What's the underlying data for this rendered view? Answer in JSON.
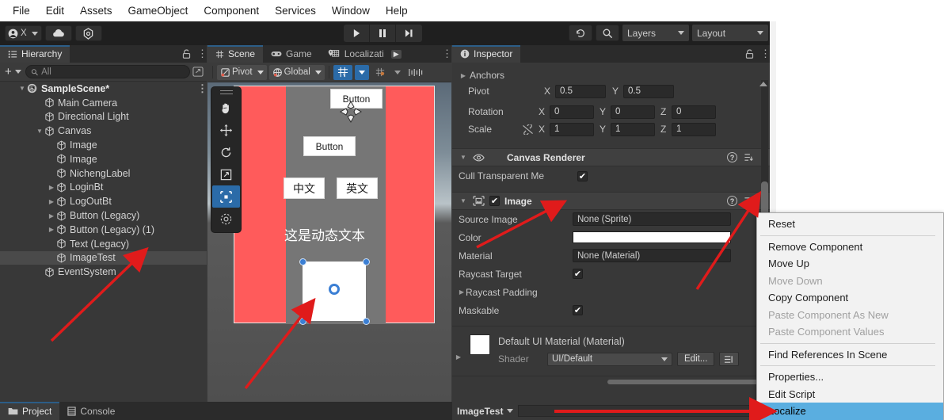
{
  "menubar": {
    "items": [
      "File",
      "Edit",
      "Assets",
      "GameObject",
      "Component",
      "Services",
      "Window",
      "Help"
    ]
  },
  "toolbar": {
    "account_label": "X",
    "cloud_icon": "cloud-icon",
    "settings_icon": "gear-icon",
    "play_icon": "play-icon",
    "pause_icon": "pause-icon",
    "step_icon": "step-icon",
    "history_icon": "undo-history-icon",
    "search_icon": "search-icon",
    "layers_label": "Layers",
    "layout_label": "Layout"
  },
  "hierarchy": {
    "tab_label": "Hierarchy",
    "lock_icon": "lock-icon",
    "menu_icon": "kebab-icon",
    "add_label": "+",
    "search_placeholder": "All",
    "scene_name": "SampleScene*",
    "items": [
      {
        "label": "Main Camera",
        "indent": 2,
        "expandable": false,
        "selected": false
      },
      {
        "label": "Directional Light",
        "indent": 2,
        "expandable": false,
        "selected": false
      },
      {
        "label": "Canvas",
        "indent": 2,
        "expandable": true,
        "expanded": true,
        "selected": false
      },
      {
        "label": "Image",
        "indent": 3,
        "expandable": false,
        "selected": false
      },
      {
        "label": "Image",
        "indent": 3,
        "expandable": false,
        "selected": false
      },
      {
        "label": "NichengLabel",
        "indent": 3,
        "expandable": false,
        "selected": false
      },
      {
        "label": "LoginBt",
        "indent": 3,
        "expandable": true,
        "expanded": false,
        "selected": false
      },
      {
        "label": "LogOutBt",
        "indent": 3,
        "expandable": true,
        "expanded": false,
        "selected": false
      },
      {
        "label": "Button (Legacy)",
        "indent": 3,
        "expandable": true,
        "expanded": false,
        "selected": false
      },
      {
        "label": "Button (Legacy) (1)",
        "indent": 3,
        "expandable": true,
        "expanded": false,
        "selected": false
      },
      {
        "label": "Text (Legacy)",
        "indent": 3,
        "expandable": false,
        "selected": false
      },
      {
        "label": "ImageTest",
        "indent": 3,
        "expandable": false,
        "selected": true
      },
      {
        "label": "EventSystem",
        "indent": 2,
        "expandable": false,
        "selected": false
      }
    ]
  },
  "scene": {
    "tabs": [
      {
        "label": "Scene",
        "icon": "grid-icon",
        "active": true
      },
      {
        "label": "Game",
        "icon": "gamepad-icon",
        "active": false
      },
      {
        "label": "Localizati",
        "icon": "localization-pin-icon",
        "active": false
      }
    ],
    "overflow_icon": "chevron-right-icon",
    "menu_icon": "kebab-icon",
    "toolbar": {
      "pivot_label": "Pivot",
      "space_label": "Global",
      "grid_icon": "grid-axis-y-icon",
      "snap_icon": "grid-snap-icon",
      "scale_icon": "scale-slider-icon"
    },
    "tools": [
      {
        "name": "hand-tool",
        "active": false
      },
      {
        "name": "move-tool",
        "active": false
      },
      {
        "name": "rotate-tool",
        "active": false
      },
      {
        "name": "scale-tool",
        "active": false
      },
      {
        "name": "rect-tool",
        "active": true
      },
      {
        "name": "transform-tool",
        "active": false
      }
    ],
    "content": {
      "button_top": "Button",
      "button_second": "Button",
      "button_cn": "中文",
      "button_en": "英文",
      "dynamic_text": "这是动态文本"
    }
  },
  "inspector": {
    "tab_label": "Inspector",
    "info_icon": "info-icon",
    "lock_icon": "lock-icon",
    "menu_icon": "kebab-icon",
    "rect_transform": {
      "anchors_label": "Anchors",
      "pivot_label": "Pivot",
      "pivot_x": "0.5",
      "pivot_y": "0.5",
      "rotation_label": "Rotation",
      "rotation_x": "0",
      "rotation_y": "0",
      "rotation_z": "0",
      "scale_label": "Scale",
      "scale_x": "1",
      "scale_y": "1",
      "scale_z": "1",
      "axis_x": "X",
      "axis_y": "Y",
      "axis_z": "Z",
      "link_icon": "broken-link-icon"
    },
    "canvas_renderer": {
      "title": "Canvas Renderer",
      "icon": "eye-icon",
      "cull_label": "Cull Transparent Me",
      "cull_checked": true
    },
    "image_component": {
      "title": "Image",
      "icon": "image-component-icon",
      "enabled": true,
      "source_image_label": "Source Image",
      "source_image_value": "None (Sprite)",
      "color_label": "Color",
      "color_value": "#FFFFFF",
      "material_label": "Material",
      "material_value": "None (Material)",
      "raycast_target_label": "Raycast Target",
      "raycast_target_checked": true,
      "raycast_padding_label": "Raycast Padding",
      "maskable_label": "Maskable",
      "maskable_checked": true
    },
    "material_block": {
      "title": "Default UI Material (Material)",
      "shader_label": "Shader",
      "shader_value": "UI/Default",
      "edit_label": "Edit...",
      "list_icon": "preset-list-icon"
    }
  },
  "context_menu": {
    "items": [
      {
        "label": "Reset",
        "state": "normal"
      },
      {
        "label": "__SEP__",
        "state": "sep"
      },
      {
        "label": "Remove Component",
        "state": "normal"
      },
      {
        "label": "Move Up",
        "state": "normal"
      },
      {
        "label": "Move Down",
        "state": "disabled"
      },
      {
        "label": "Copy Component",
        "state": "normal"
      },
      {
        "label": "Paste Component As New",
        "state": "disabled"
      },
      {
        "label": "Paste Component Values",
        "state": "disabled"
      },
      {
        "label": "__SEP__",
        "state": "sep"
      },
      {
        "label": "Find References In Scene",
        "state": "normal"
      },
      {
        "label": "__SEP__",
        "state": "sep"
      },
      {
        "label": "Properties...",
        "state": "normal"
      },
      {
        "label": "Edit Script",
        "state": "normal"
      },
      {
        "label": "Localize",
        "state": "highlight"
      }
    ]
  },
  "bottom": {
    "project_label": "Project",
    "console_label": "Console",
    "project_icon": "folder-icon",
    "console_icon": "console-icon",
    "lock_icon": "lock-icon",
    "menu_icon": "kebab-icon",
    "selected_object": "ImageTest"
  },
  "colors": {
    "accent_blue": "#2b6ba8",
    "highlight_blue": "#5aaee0",
    "canvas_red": "#ff5b5b",
    "annotation_red": "#e01b1b",
    "panel_bg": "#383838",
    "toolbar_bg": "#1f1f1f"
  }
}
